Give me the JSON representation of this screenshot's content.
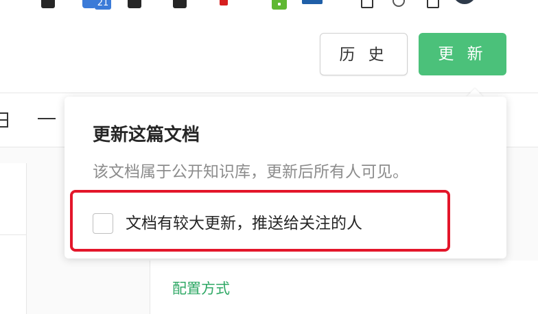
{
  "bookmarks_bar": {
    "calendar_badge": "21"
  },
  "header": {
    "history_label": "历 史",
    "update_label": "更 新"
  },
  "popover": {
    "title": "更新这篇文档",
    "description": "该文档属于公开知识库，更新后所有人可见。",
    "push_checkbox_label": "文档有较大更新，推送给关注的人",
    "push_checkbox_checked": false,
    "highlight_color": "#e3162a"
  },
  "document": {
    "config_link": "配置方式"
  },
  "colors": {
    "accent_green": "#4bc17a",
    "link_green": "#2fa865"
  }
}
